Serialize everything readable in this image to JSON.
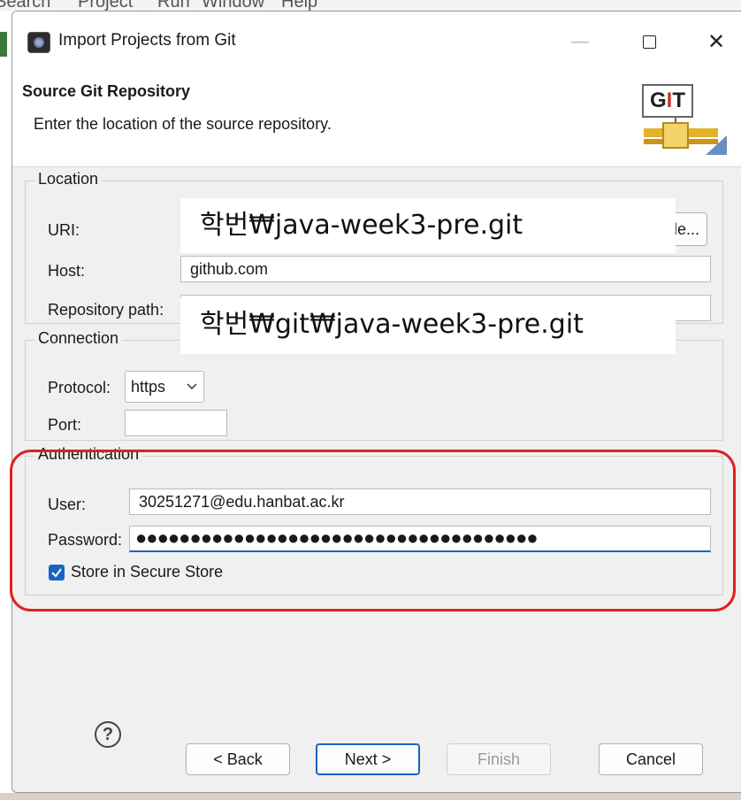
{
  "menubar": {
    "items": [
      "Search",
      "Project",
      "Run",
      "Window",
      "Help"
    ]
  },
  "window": {
    "title": "Import Projects from Git",
    "minimize": "—",
    "close": "✕"
  },
  "header": {
    "title": "Source Git Repository",
    "description": "Enter the location of the source repository.",
    "logo_text_g": "G",
    "logo_text_i": "I",
    "logo_text_t": "T"
  },
  "location": {
    "legend": "Location",
    "uri_label": "URI:",
    "uri_value": "",
    "local_file_button": "le...",
    "host_label": "Host:",
    "host_value": "github.com",
    "path_label": "Repository path:",
    "path_value": "",
    "uri_overlay": "학번₩java-week3-pre.git",
    "path_overlay": "학번₩git₩java-week3-pre.git"
  },
  "connection": {
    "legend": "Connection",
    "protocol_label": "Protocol:",
    "protocol_value": "https",
    "port_label": "Port:",
    "port_value": ""
  },
  "authentication": {
    "legend": "Authentication",
    "user_label": "User:",
    "user_value": "30251271@edu.hanbat.ac.kr",
    "password_label": "Password:",
    "password_value": "●●●●●●●●●●●●●●●●●●●●●●●●●●●●●●●●●●●●●",
    "store_label": "Store in Secure Store",
    "store_checked": true
  },
  "buttons": {
    "help": "?",
    "back": "< Back",
    "next": "Next >",
    "finish": "Finish",
    "cancel": "Cancel"
  },
  "colors": {
    "accent": "#1a63c0",
    "highlight": "#e02020"
  }
}
